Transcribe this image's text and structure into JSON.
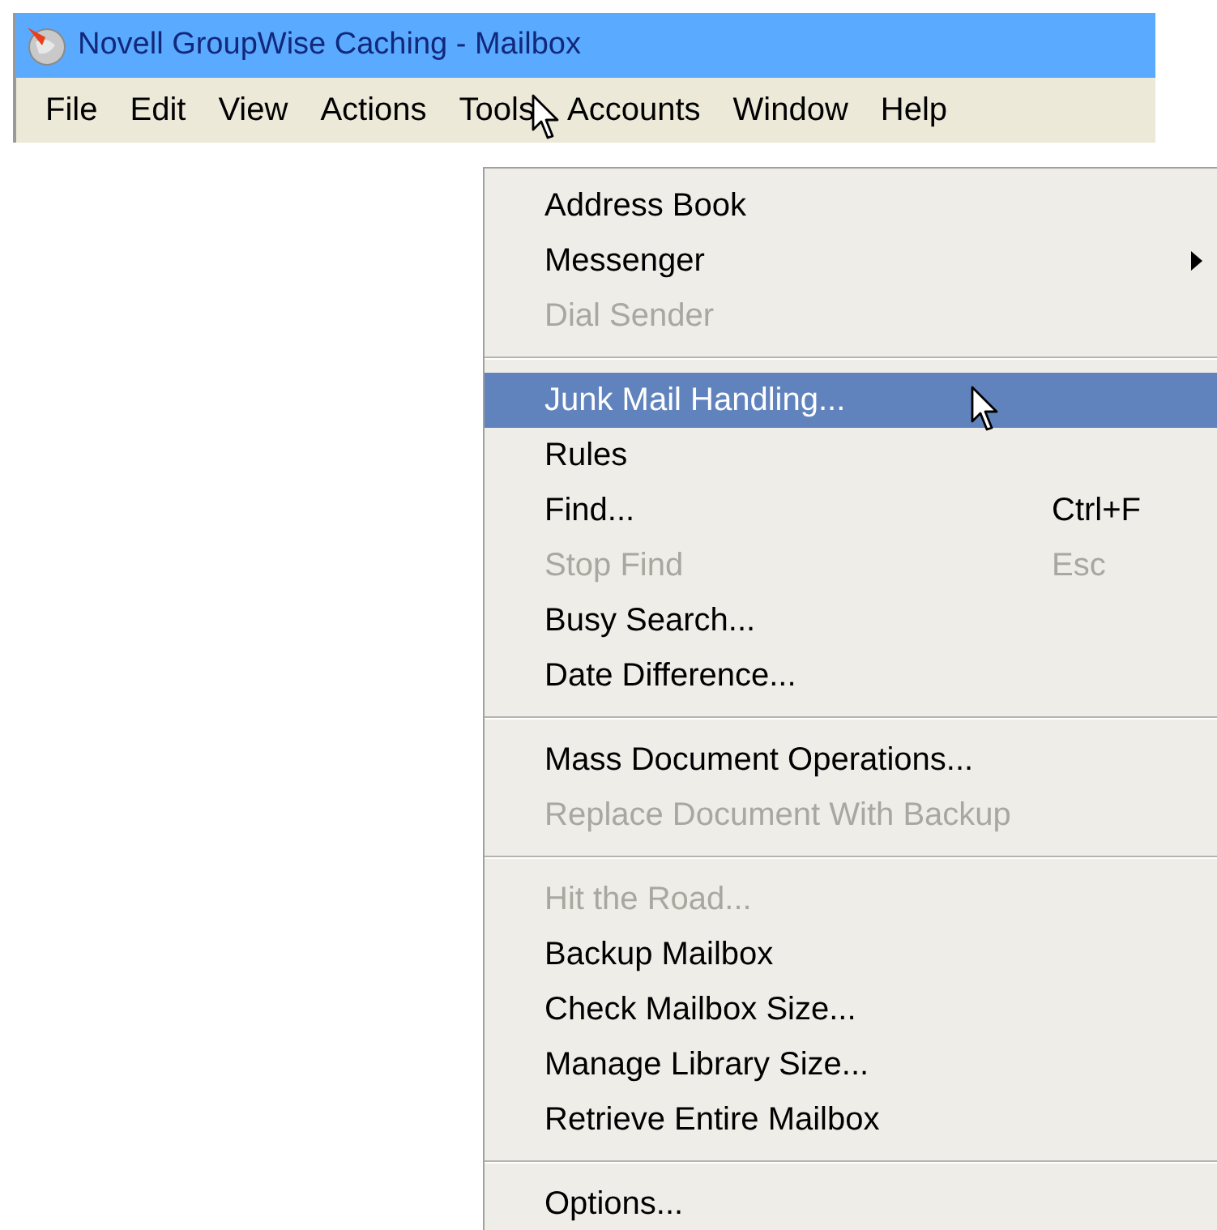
{
  "window": {
    "title": "Novell GroupWise Caching - Mailbox"
  },
  "menu_bar": [
    "File",
    "Edit",
    "View",
    "Actions",
    "Tools",
    "Accounts",
    "Window",
    "Help"
  ],
  "menu": [
    {
      "kind": "item",
      "label": "Address Book",
      "disabled": false,
      "selected": false
    },
    {
      "kind": "item",
      "label": "Messenger",
      "disabled": false,
      "selected": false,
      "submenu": true
    },
    {
      "kind": "item",
      "label": "Dial Sender",
      "disabled": true,
      "selected": false
    },
    {
      "kind": "separator"
    },
    {
      "kind": "item",
      "label": "Junk Mail Handling...",
      "disabled": false,
      "selected": true
    },
    {
      "kind": "item",
      "label": "Rules",
      "disabled": false,
      "selected": false
    },
    {
      "kind": "item",
      "label": "Find...",
      "disabled": false,
      "selected": false,
      "shortcut": "Ctrl+F"
    },
    {
      "kind": "item",
      "label": "Stop Find",
      "disabled": true,
      "selected": false,
      "shortcut": "Esc"
    },
    {
      "kind": "item",
      "label": "Busy Search...",
      "disabled": false,
      "selected": false
    },
    {
      "kind": "item",
      "label": "Date Difference...",
      "disabled": false,
      "selected": false
    },
    {
      "kind": "separator"
    },
    {
      "kind": "item",
      "label": "Mass Document Operations...",
      "disabled": false,
      "selected": false
    },
    {
      "kind": "item",
      "label": "Replace Document With Backup",
      "disabled": true,
      "selected": false
    },
    {
      "kind": "separator"
    },
    {
      "kind": "item",
      "label": "Hit the Road...",
      "disabled": true,
      "selected": false
    },
    {
      "kind": "item",
      "label": "Backup Mailbox",
      "disabled": false,
      "selected": false
    },
    {
      "kind": "item",
      "label": "Check Mailbox Size...",
      "disabled": false,
      "selected": false
    },
    {
      "kind": "item",
      "label": "Manage Library Size...",
      "disabled": false,
      "selected": false
    },
    {
      "kind": "item",
      "label": "Retrieve Entire Mailbox",
      "disabled": false,
      "selected": false
    },
    {
      "kind": "separator"
    },
    {
      "kind": "item",
      "label": "Options...",
      "disabled": false,
      "selected": false
    }
  ]
}
